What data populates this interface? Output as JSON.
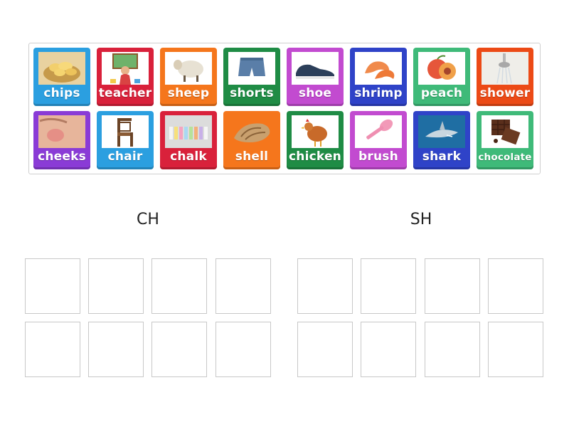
{
  "cards": [
    {
      "label": "chips",
      "color": "#2b9fe0",
      "icon": "chips-image"
    },
    {
      "label": "teacher",
      "color": "#d9213b",
      "icon": "teacher-image"
    },
    {
      "label": "sheep",
      "color": "#f5761c",
      "icon": "sheep-image"
    },
    {
      "label": "shorts",
      "color": "#1f8c45",
      "icon": "shorts-image"
    },
    {
      "label": "shoe",
      "color": "#c24bd0",
      "icon": "shoe-image"
    },
    {
      "label": "shrimp",
      "color": "#2f43c8",
      "icon": "shrimp-image"
    },
    {
      "label": "peach",
      "color": "#3fba79",
      "icon": "peach-image"
    },
    {
      "label": "shower",
      "color": "#ec4a16",
      "icon": "shower-image"
    },
    {
      "label": "cheeks",
      "color": "#8a3bd6",
      "icon": "cheeks-image"
    },
    {
      "label": "chair",
      "color": "#2b9fe0",
      "icon": "chair-image"
    },
    {
      "label": "chalk",
      "color": "#d9213b",
      "icon": "chalk-image"
    },
    {
      "label": "shell",
      "color": "#f5761c",
      "icon": "shell-image"
    },
    {
      "label": "chicken",
      "color": "#1f8c45",
      "icon": "chicken-image"
    },
    {
      "label": "brush",
      "color": "#c24bd0",
      "icon": "brush-image"
    },
    {
      "label": "shark",
      "color": "#2f43c8",
      "icon": "shark-image"
    },
    {
      "label": "chocolate",
      "color": "#3fba79",
      "icon": "chocolate-image"
    }
  ],
  "zones": [
    {
      "title": "CH"
    },
    {
      "title": "SH"
    }
  ]
}
